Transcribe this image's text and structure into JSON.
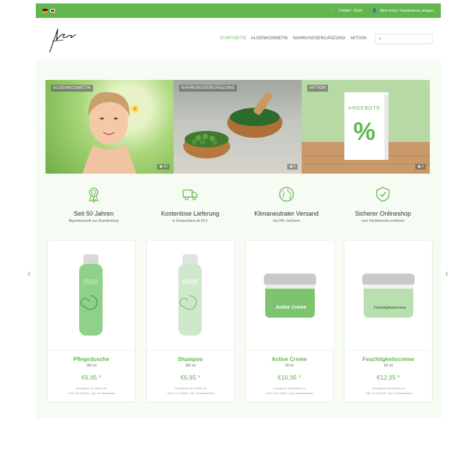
{
  "topbar": {
    "cart_text": "0 Artikel · €0,00",
    "account_text": "Mein Konto / Kundenkonto anlegen",
    "bg_color": "#62b64e"
  },
  "nav": {
    "items": [
      "STARTSEITE",
      "ALGENKOSMETIK",
      "NAHRUNGSERGÄNZUNG",
      "AKTION"
    ],
    "active_index": 0
  },
  "search": {
    "placeholder": ""
  },
  "banners": [
    {
      "label": "ALGENKOSMETIK",
      "count": "10"
    },
    {
      "label": "NAHRUNGSERGÄNZUNG",
      "count": "6"
    },
    {
      "label": "AKTION",
      "count": "2",
      "card_text": "ANGEBOTE",
      "card_symbol": "%"
    }
  ],
  "features": [
    {
      "title": "Seit 50 Jahren",
      "subtitle": "Algenkosmetik aus Brandenburg",
      "icon": "award-icon"
    },
    {
      "title": "Kostenlose Lieferung",
      "subtitle": "in Deutschland ab 50 €",
      "icon": "truck-icon"
    },
    {
      "title": "Klimaneutraler Versand",
      "subtitle": "mit DHL GoGreen",
      "icon": "globe-icon"
    },
    {
      "title": "Sicherer Onlineshop",
      "subtitle": "vom Händlerbund zertifiziert",
      "icon": "shield-check-icon"
    }
  ],
  "products": [
    {
      "name": "Pflegedusche",
      "size": "250 ml",
      "price": "€6,95 *",
      "base_price": "Grundpreis: €2,78/100 ml",
      "tax": "* Inkl. 19 % MwSt. zzgl. Versandkosten",
      "kind": "bottle",
      "tint": "#8fd08a"
    },
    {
      "name": "Shampoo",
      "size": "250 ml",
      "price": "€6,95 *",
      "base_price": "Grundpreis: €2,78/100 ml",
      "tax": "* Inkl. 19 % MwSt. zzgl. Versandkosten",
      "kind": "bottle",
      "tint": "#cfe8cc"
    },
    {
      "name": "Active Creme",
      "size": "50 ml",
      "price": "€16,95 *",
      "base_price": "Grundpreis: €33,90/100 ml",
      "tax": "* Inkl. 19 % MwSt. zzgl. Versandkosten",
      "kind": "jar",
      "tint": "#7cc46e",
      "jar_text": "Active Creme"
    },
    {
      "name": "Feuchtigkeitscreme",
      "size": "50 ml",
      "price": "€12,95 *",
      "base_price": "Grundpreis: €25,90/100 ml",
      "tax": "* Inkl. 19 % MwSt. zzgl. Versandkosten",
      "kind": "jar",
      "tint": "#b9dfb0",
      "jar_text": "Feuchtigkeitscreme"
    }
  ],
  "carousel": {
    "prev": "‹",
    "next": "›"
  },
  "colors": {
    "accent": "#62b64e",
    "background": "#f6fbf4"
  }
}
